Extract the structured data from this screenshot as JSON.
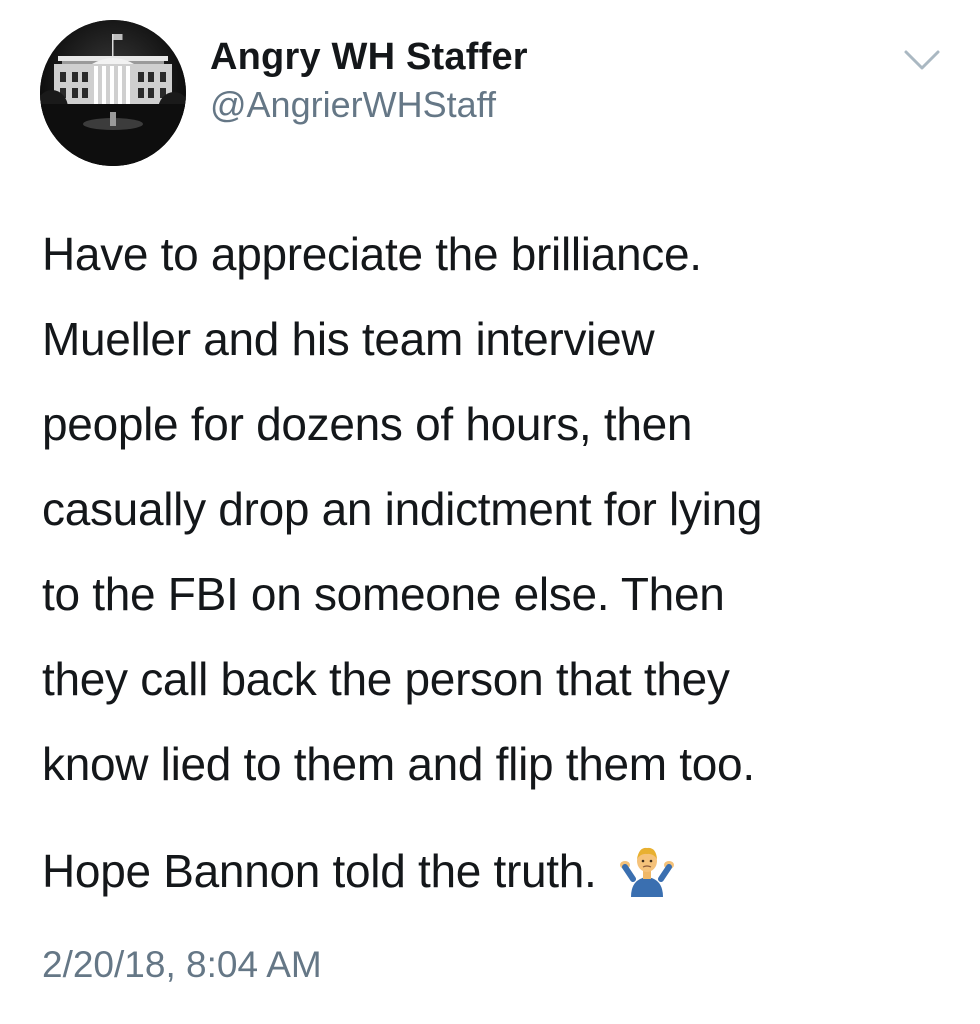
{
  "author": {
    "display_name": "Angry WH Staffer",
    "handle": "@AngrierWHStaff",
    "avatar_icon": "white-house-icon"
  },
  "tweet": {
    "lines": [
      "Have to appreciate the brilliance.",
      "Mueller and his team interview",
      "people for dozens of hours, then",
      "casually drop an indictment for lying",
      "to the FBI on someone else. Then",
      "they call back the person that they",
      "know lied to them and flip them too."
    ],
    "second_paragraph": "Hope Bannon told the truth.",
    "emoji": "man-shrugging-emoji"
  },
  "timestamp": "2/20/18, 8:04 AM",
  "menu": {
    "icon": "chevron-down-icon"
  },
  "colors": {
    "text": "#14171a",
    "secondary": "#657786",
    "background": "#ffffff"
  }
}
